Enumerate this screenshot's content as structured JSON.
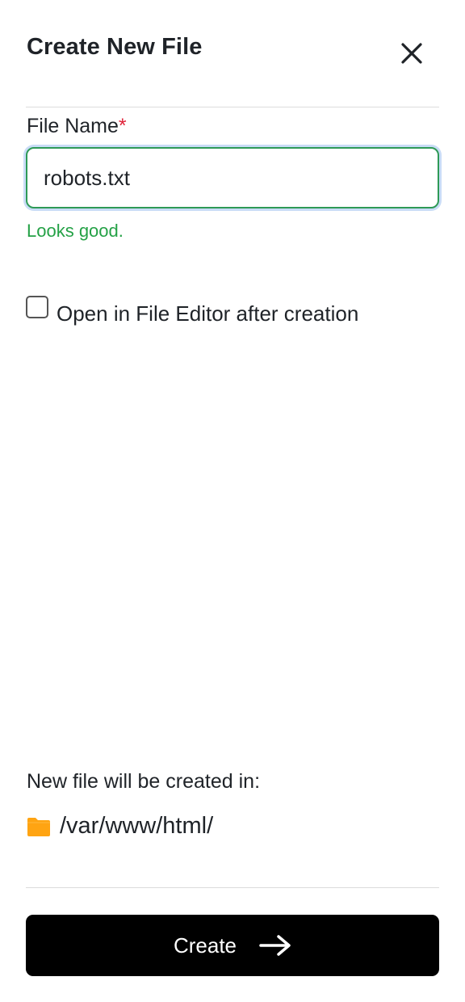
{
  "dialog": {
    "title": "Create New File",
    "close_icon": "close-icon"
  },
  "form": {
    "file_name_label": "File Name",
    "required_marker": "*",
    "file_name_value": "robots.txt",
    "validation_message": "Looks good.",
    "open_in_editor_label": "Open in File Editor after creation",
    "open_in_editor_checked": false
  },
  "location": {
    "label": "New file will be created in:",
    "folder_icon": "folder-icon",
    "path": "/var/www/html/"
  },
  "actions": {
    "create_label": "Create",
    "create_icon": "arrow-right-icon"
  },
  "colors": {
    "valid_green": "#24a146",
    "required_red": "#e0243a",
    "folder_orange": "#ffa412",
    "button_bg": "#000000"
  }
}
